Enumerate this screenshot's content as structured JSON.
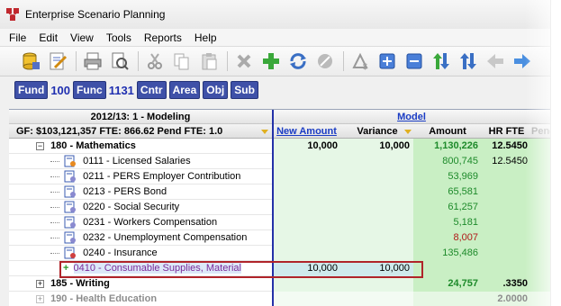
{
  "window": {
    "title": "Enterprise Scenario Planning"
  },
  "menu": [
    "File",
    "Edit",
    "View",
    "Tools",
    "Reports",
    "Help"
  ],
  "toolbar": {
    "icons": [
      "database-icon",
      "edit-icon",
      "print-icon",
      "print-preview-icon",
      "cut-icon",
      "copy-icon",
      "paste-icon",
      "delete-icon",
      "add-icon",
      "refresh-icon",
      "cancel-icon",
      "sum-icon",
      "expand-icon",
      "collapse-icon",
      "sort-asc-icon",
      "sort-desc-icon",
      "back-icon",
      "forward-icon"
    ]
  },
  "keys": {
    "fund_label": "Fund",
    "fund_value": "100",
    "func_label": "Func",
    "func_value": "1131",
    "cntr_label": "Cntr",
    "area_label": "Area",
    "obj_label": "Obj",
    "sub_label": "Sub"
  },
  "grid": {
    "period": "2012/13: 1 - Modeling",
    "model_link": "Model",
    "summary": "GF: $103,121,357  FTE: 866.62  Pend FTE: 1.0",
    "col_new": "New Amount",
    "col_var": "Variance",
    "col_amt": "Amount",
    "col_hr": "HR FTE",
    "col_pen": "Pend",
    "rows": [
      {
        "label": "180 - Mathematics",
        "new": "10,000",
        "var": "10,000",
        "amt": "1,130,226",
        "hr": "12.5450"
      },
      {
        "label": "0111 - Licensed Salaries",
        "new": "",
        "var": "",
        "amt": "800,745",
        "hr": "12.5450"
      },
      {
        "label": "0211 - PERS Employer Contribution",
        "new": "",
        "var": "",
        "amt": "53,969",
        "hr": ""
      },
      {
        "label": "0213 - PERS Bond",
        "new": "",
        "var": "",
        "amt": "65,581",
        "hr": ""
      },
      {
        "label": "0220 - Social Security",
        "new": "",
        "var": "",
        "amt": "61,257",
        "hr": ""
      },
      {
        "label": "0231 - Workers Compensation",
        "new": "",
        "var": "",
        "amt": "5,181",
        "hr": ""
      },
      {
        "label": "0232 - Unemployment Compensation",
        "new": "",
        "var": "",
        "amt": "8,007",
        "hr": ""
      },
      {
        "label": "0240 - Insurance",
        "new": "",
        "var": "",
        "amt": "135,486",
        "hr": ""
      },
      {
        "label": "0410 - Consumable Supplies, Material",
        "new": "10,000",
        "var": "10,000",
        "amt": "",
        "hr": ""
      },
      {
        "label": "185 - Writing",
        "new": "",
        "var": "",
        "amt": "24,757",
        "hr": ".3350"
      },
      {
        "label": "190 - Health Education",
        "new": "",
        "var": "",
        "amt": "",
        "hr": "2.0000"
      }
    ]
  },
  "colors": {
    "key_label_bg": "#3f51a8",
    "key_value": "#1f2fb0",
    "positive": "#1d8a2a",
    "negative": "#b01818",
    "highlight_border": "#b0242a"
  }
}
